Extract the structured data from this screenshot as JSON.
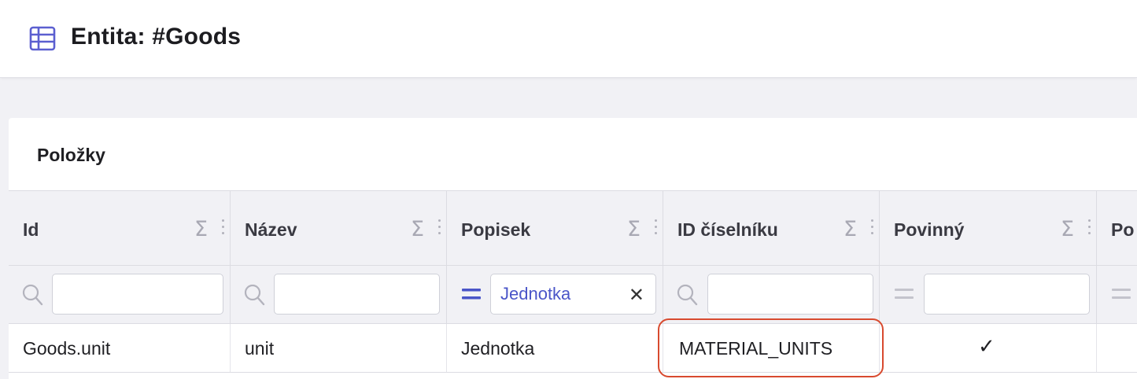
{
  "header": {
    "title": "Entita: #Goods",
    "icon": "table-icon",
    "icon_color": "#5b5fd0"
  },
  "section": {
    "title": "Položky"
  },
  "columns": [
    {
      "label": "Id"
    },
    {
      "label": "Název"
    },
    {
      "label": "Popisek"
    },
    {
      "label": "ID číselníku"
    },
    {
      "label": "Povinný"
    },
    {
      "label": "Po"
    }
  ],
  "filters": [
    {
      "mode": "search",
      "value": ""
    },
    {
      "mode": "search",
      "value": ""
    },
    {
      "mode": "equals",
      "value": "Jednotka"
    },
    {
      "mode": "search",
      "value": ""
    },
    {
      "mode": "equals",
      "value": ""
    },
    {
      "mode": "equals",
      "value": ""
    }
  ],
  "rows": [
    {
      "id": "Goods.unit",
      "name": "unit",
      "label": "Jednotka",
      "codelist_id": "MATERIAL_UNITS",
      "required": "✓"
    }
  ],
  "colors": {
    "accent": "#4a55c8",
    "highlight_border": "#d84a2f",
    "header_bg": "#f1f1f5"
  }
}
